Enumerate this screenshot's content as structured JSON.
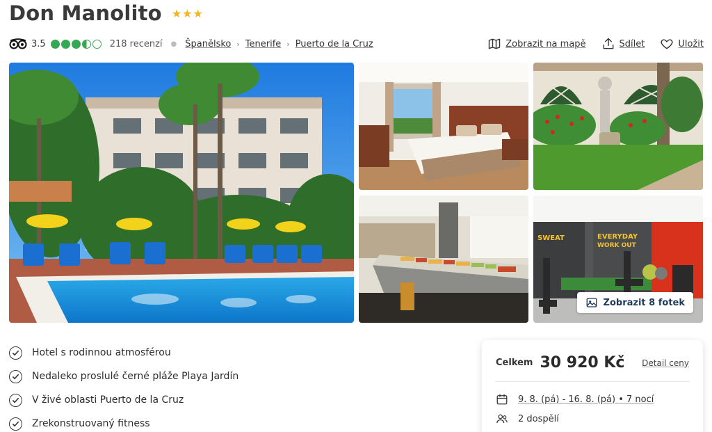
{
  "hotel": {
    "name": "Don Manolito",
    "stars": "★★★",
    "rating": "3.5",
    "reviews": "218 recenzí"
  },
  "breadcrumbs": [
    "Španělsko",
    "Tenerife",
    "Puerto de la Cruz"
  ],
  "actions": {
    "map": "Zobrazit na mapě",
    "share": "Sdílet",
    "save": "Uložit"
  },
  "gallery": {
    "show_photos": "Zobrazit 8 fotek",
    "gym_sign_1": "SWEAT",
    "gym_sign_2": "EVERYDAY",
    "gym_sign_3": "WORK OUT"
  },
  "features": [
    "Hotel s rodinnou atmosférou",
    "Nedaleko proslulé černé pláže Playa Jardín",
    "V živé oblasti Puerto de la Cruz",
    "Zrekonstruovaný fitness"
  ],
  "price": {
    "label": "Celkem",
    "value": "30 920 Kč",
    "detail": "Detail ceny",
    "dates": "9. 8. (pá) - 16. 8. (pá) • 7 nocí",
    "guests": "2 dospělí"
  },
  "colors": {
    "rating_green": "#34a853",
    "star_gold": "#f3b51a",
    "button_text": "#1d3a5c"
  }
}
